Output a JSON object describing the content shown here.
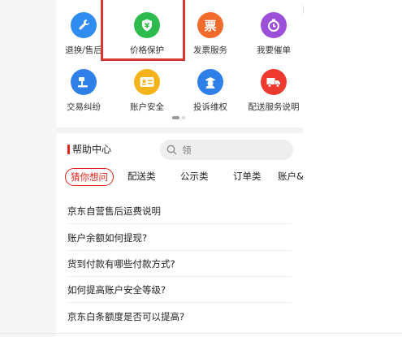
{
  "services": [
    {
      "label": "退换/售后",
      "icon": "wrench-icon",
      "glyph": "",
      "color": "#2f8cf0"
    },
    {
      "label": "价格保护",
      "icon": "yen-shield-icon",
      "glyph": "¥",
      "color": "#2dbb4e"
    },
    {
      "label": "发票服务",
      "icon": "invoice-icon",
      "glyph": "票",
      "color": "#f26b2a"
    },
    {
      "label": "我要催单",
      "icon": "timer-icon",
      "glyph": "",
      "color": "#9c4fd8"
    },
    {
      "label": "交易纠纷",
      "icon": "gavel-icon",
      "glyph": "",
      "color": "#2f7fe8"
    },
    {
      "label": "账户安全",
      "icon": "id-card-icon",
      "glyph": "",
      "color": "#f5b31a"
    },
    {
      "label": "投诉维权",
      "icon": "officer-icon",
      "glyph": "",
      "color": "#2f7fe8"
    },
    {
      "label": "配送服务说明",
      "icon": "delivery-truck-icon",
      "glyph": "",
      "color": "#ee3a2e"
    }
  ],
  "help_center": {
    "title": "帮助中心",
    "search_placeholder": "领"
  },
  "tabs": [
    "猜你想问",
    "配送类",
    "公示类",
    "订单类",
    "账户&"
  ],
  "active_tab": 0,
  "faq": [
    "京东自营售后运费说明",
    "账户余额如何提现?",
    "货到付款有哪些付款方式?",
    "如何提高账户安全等级?",
    "京东白条额度是否可以提高?"
  ],
  "colors": {
    "accent": "#e2231a",
    "highlight": "#d43a2f"
  }
}
